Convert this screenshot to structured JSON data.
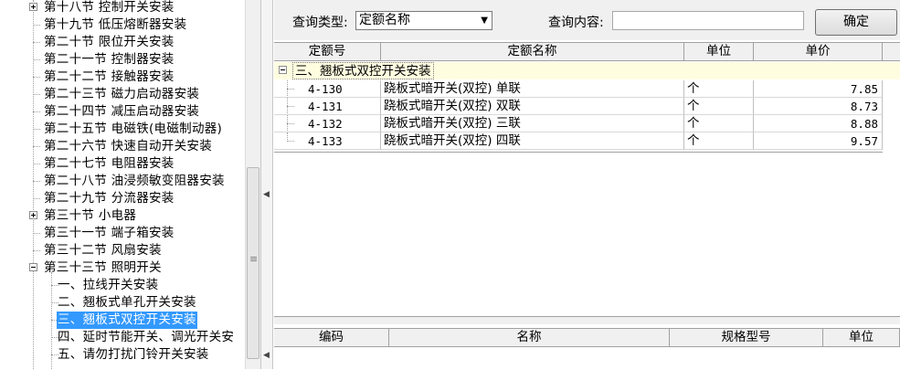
{
  "tree": {
    "items": [
      {
        "label": "第十八节 控制开关安装",
        "level": 0,
        "expander": "plus"
      },
      {
        "label": "第十九节 低压熔断器安装",
        "level": 0,
        "expander": "none"
      },
      {
        "label": "第二十节 限位开关安装",
        "level": 0,
        "expander": "none"
      },
      {
        "label": "第二十一节 控制器安装",
        "level": 0,
        "expander": "none"
      },
      {
        "label": "第二十二节 接触器安装",
        "level": 0,
        "expander": "none"
      },
      {
        "label": "第二十三节 磁力启动器安装",
        "level": 0,
        "expander": "none"
      },
      {
        "label": "第二十四节 减压启动器安装",
        "level": 0,
        "expander": "none"
      },
      {
        "label": "第二十五节 电磁铁(电磁制动器)",
        "level": 0,
        "expander": "none"
      },
      {
        "label": "第二十六节 快速自动开关安装",
        "level": 0,
        "expander": "none"
      },
      {
        "label": "第二十七节 电阻器安装",
        "level": 0,
        "expander": "none"
      },
      {
        "label": "第二十八节 油浸频敏变阻器安装",
        "level": 0,
        "expander": "none"
      },
      {
        "label": "第二十九节 分流器安装",
        "level": 0,
        "expander": "none"
      },
      {
        "label": "第三十节 小电器",
        "level": 0,
        "expander": "plus"
      },
      {
        "label": "第三十一节 端子箱安装",
        "level": 0,
        "expander": "none"
      },
      {
        "label": "第三十二节 风扇安装",
        "level": 0,
        "expander": "none"
      },
      {
        "label": "第三十三节 照明开关",
        "level": 0,
        "expander": "minus"
      },
      {
        "label": "一、拉线开关安装",
        "level": 1,
        "expander": "none"
      },
      {
        "label": "二、翘板式单孔开关安装",
        "level": 1,
        "expander": "none"
      },
      {
        "label": "三、翘板式双控开关安装",
        "level": 1,
        "expander": "none",
        "selected": true
      },
      {
        "label": "四、延时节能开关、调光开关安",
        "level": 1,
        "expander": "none"
      },
      {
        "label": "五、请勿打扰门铃开关安装",
        "level": 1,
        "expander": "none"
      }
    ]
  },
  "query": {
    "type_label": "查询类型:",
    "type_value": "定额名称",
    "content_label": "查询内容:",
    "content_value": "",
    "confirm_label": "确定"
  },
  "quota_table": {
    "headers": [
      "定额号",
      "定额名称",
      "单位",
      "单价"
    ],
    "group": "三、翘板式双控开关安装",
    "rows": [
      {
        "code": "4-130",
        "name": "跷板式暗开关(双控) 单联",
        "unit": "个",
        "price": "7.85"
      },
      {
        "code": "4-131",
        "name": "跷板式暗开关(双控) 双联",
        "unit": "个",
        "price": "8.73"
      },
      {
        "code": "4-132",
        "name": "跷板式暗开关(双控) 三联",
        "unit": "个",
        "price": "8.88"
      },
      {
        "code": "4-133",
        "name": "跷板式暗开关(双控) 四联",
        "unit": "个",
        "price": "9.57"
      }
    ]
  },
  "material_table": {
    "headers": [
      "编码",
      "名称",
      "规格型号",
      "单位"
    ]
  },
  "icons": {
    "expand": "plus-box-icon",
    "collapse": "minus-box-icon",
    "dropdown": "dropdown-arrow-icon",
    "split_left": "left-arrow-icon"
  },
  "colors": {
    "selection": "#3399ff",
    "group_row_bg": "#fffde0",
    "panel_bg": "#f0f0f0"
  }
}
